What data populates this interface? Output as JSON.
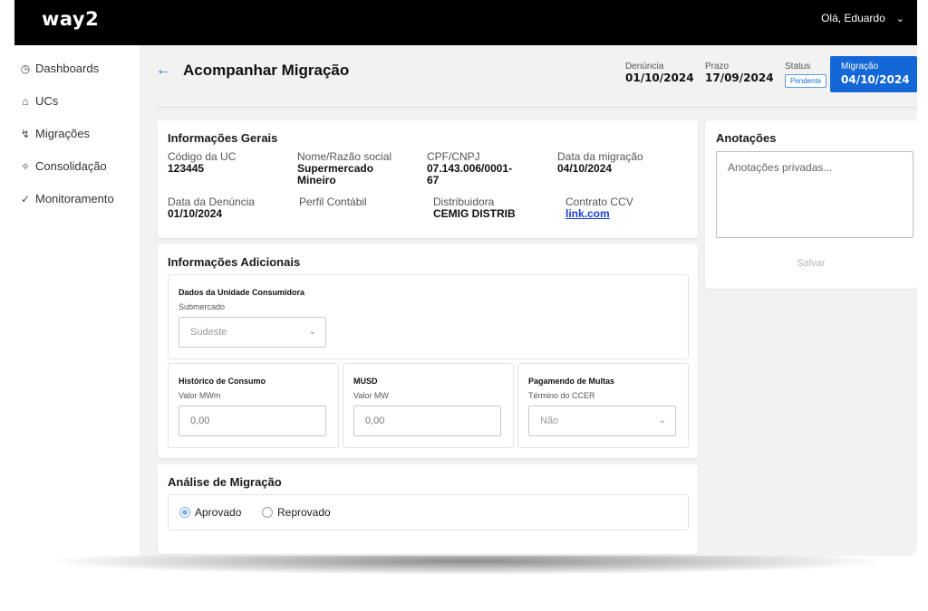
{
  "topbar": {
    "logo": "way2",
    "user_greeting": "Olá, Eduardo"
  },
  "sidebar": {
    "items": [
      {
        "label": "Dashboards",
        "icon": "clock-icon"
      },
      {
        "label": "UCs",
        "icon": "building-icon"
      },
      {
        "label": "Migrações",
        "icon": "lightning-icon"
      },
      {
        "label": "Consolidação",
        "icon": "sparkle-icon"
      },
      {
        "label": "Monitoramento",
        "icon": "check-circle-icon"
      }
    ]
  },
  "header": {
    "title": "Acompanhar Migração",
    "denuncia_label": "Denúncia",
    "denuncia_value": "01/10/2024",
    "prazo_label": "Prazo",
    "prazo_value": "17/09/2024",
    "status_label": "Status",
    "status_value": "Pendente",
    "migracao_label": "Migração",
    "migracao_value": "04/10/2024"
  },
  "info_gerais": {
    "title": "Informações Gerais",
    "codigo_uc_label": "Código da UC",
    "codigo_uc_value": "123445",
    "nome_label": "Nome/Razão social",
    "nome_value_1": "Supermercado",
    "nome_value_2": "Mineiro",
    "cpf_label": "CPF/CNPJ",
    "cpf_value_1": "07.143.006/0001-",
    "cpf_value_2": "67",
    "data_migracao_label": "Data da migração",
    "data_migracao_value": "04/10/2024",
    "data_denuncia_label": "Data da Denúncia",
    "data_denuncia_value": "01/10/2024",
    "perfil_label": "Perfil Contábil",
    "distribuidora_label": "Distribuidora",
    "distribuidora_value": "CEMIG DISTRIB",
    "contrato_label": "Contrato CCV",
    "contrato_value": "link.com"
  },
  "info_adicionais": {
    "title": "Informações Adicionais",
    "dados_uc_title": "Dados da Unidade Consumidora",
    "submercado_label": "Submercado",
    "submercado_value": "Sudeste",
    "historico_title": "Histórico de Consumo",
    "historico_label": "Valor MWm",
    "historico_placeholder": "0,00",
    "musd_title": "MUSD",
    "musd_label": "Valor MW",
    "musd_placeholder": "0,00",
    "multas_title": "Pagamendo de Multas",
    "multas_label": "Término do CCER",
    "multas_value": "Não"
  },
  "analise": {
    "title": "Análise de Migração",
    "options": [
      "Aprovado",
      "Reprovado"
    ],
    "selected": "Aprovado"
  },
  "anotacoes": {
    "title": "Anotações",
    "placeholder": "Anotações privadas...",
    "save_label": "Salvar"
  }
}
